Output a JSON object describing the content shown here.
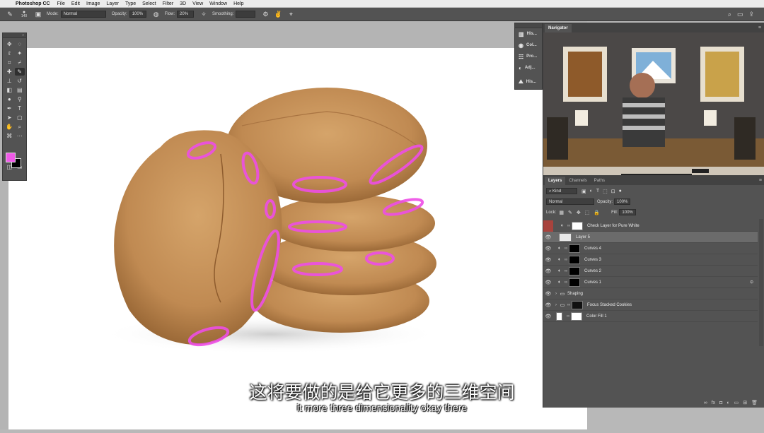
{
  "menubar": {
    "app_name": "Photoshop CC",
    "items": [
      "File",
      "Edit",
      "Image",
      "Layer",
      "Type",
      "Select",
      "Filter",
      "3D",
      "View",
      "Window",
      "Help"
    ]
  },
  "options_bar": {
    "brush_size": "140",
    "mode_label": "Mode:",
    "mode_value": "Normal",
    "opacity_label": "Opacity:",
    "opacity_value": "100%",
    "flow_label": "Flow:",
    "flow_value": "20%",
    "smoothing_label": "Smoothing:"
  },
  "dock": {
    "items": [
      {
        "label": "His...",
        "icon": "histogram-icon"
      },
      {
        "label": "Col...",
        "icon": "color-icon"
      },
      {
        "label": "Pro...",
        "icon": "properties-icon"
      },
      {
        "label": "Adj...",
        "icon": "adjustments-icon"
      },
      {
        "label": "His...",
        "icon": "history-icon"
      }
    ]
  },
  "navigator": {
    "tab": "Navigator"
  },
  "layers": {
    "tabs": [
      "Layers",
      "Channels",
      "Paths"
    ],
    "filter_kind": "Kind",
    "blend_mode": "Normal",
    "opacity_label": "Opacity:",
    "opacity_value": "100%",
    "lock_label": "Lock:",
    "fill_label": "Fill:",
    "fill_value": "100%",
    "list": [
      {
        "name": "Check Layer for Pure White",
        "visible": false,
        "selected": false,
        "type": "adjustment",
        "thumb": "#ffffff"
      },
      {
        "name": "Layer 5",
        "visible": true,
        "selected": true,
        "type": "pixel",
        "thumb": "#e8e8e8"
      },
      {
        "name": "Curves 4",
        "visible": true,
        "selected": false,
        "type": "adjustment",
        "thumb": "#000000"
      },
      {
        "name": "Curves 3",
        "visible": true,
        "selected": false,
        "type": "adjustment",
        "thumb": "#000000"
      },
      {
        "name": "Curves 2",
        "visible": true,
        "selected": false,
        "type": "adjustment",
        "thumb": "#000000"
      },
      {
        "name": "Curves 1",
        "visible": true,
        "selected": false,
        "type": "adjustment",
        "thumb": "#000000"
      },
      {
        "name": "Shaping",
        "visible": true,
        "selected": false,
        "type": "group",
        "thumb": ""
      },
      {
        "name": "Focus Stacked Cookies",
        "visible": true,
        "selected": false,
        "type": "group",
        "thumb": "#111111"
      },
      {
        "name": "Color Fill 1",
        "visible": true,
        "selected": false,
        "type": "fill",
        "thumb": "#ffffff"
      }
    ]
  },
  "colors": {
    "foreground": "#f05ae8",
    "background": "#000000",
    "highlight_strokes": "#ee4ee6",
    "cookie": "#c48e56"
  },
  "subtitles": {
    "chinese": "这将要做的是给它更多的三维空间",
    "english": "it more three dimensionality okay there"
  }
}
